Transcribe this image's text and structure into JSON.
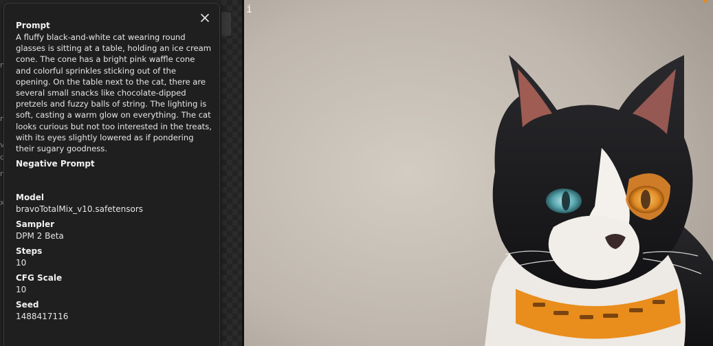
{
  "viewer": {
    "info_glyph": "i"
  },
  "panel": {
    "close_glyph": "×",
    "prompt": {
      "label": "Prompt",
      "value": "A fluffy black-and-white cat wearing round glasses is sitting at a table, holding an ice cream cone. The cone has a bright pink waffle cone and colorful sprinkles sticking out of the opening. On the table next to the cat, there are several small snacks like chocolate-dipped pretzels and fuzzy balls of string. The lighting is soft, casting a warm glow on everything. The cat looks curious but not too interested in the treats, with its eyes slightly lowered as if pondering their sugary goodness."
    },
    "negative_prompt": {
      "label": "Negative Prompt",
      "value": ""
    },
    "model": {
      "label": "Model",
      "value": "bravoTotalMix_v10.safetensors"
    },
    "sampler": {
      "label": "Sampler",
      "value": "DPM 2 Beta"
    },
    "steps": {
      "label": "Steps",
      "value": "10"
    },
    "cfg_scale": {
      "label": "CFG Scale",
      "value": "10"
    },
    "seed": {
      "label": "Seed",
      "value": "1488417116"
    }
  },
  "edge_chars": [
    "n",
    "n",
    "v",
    "c",
    "n",
    "x"
  ],
  "colors": {
    "panel_bg": "#1f1f1f",
    "panel_border": "#3a3a3a",
    "collar_orange": "#e98d1c"
  }
}
